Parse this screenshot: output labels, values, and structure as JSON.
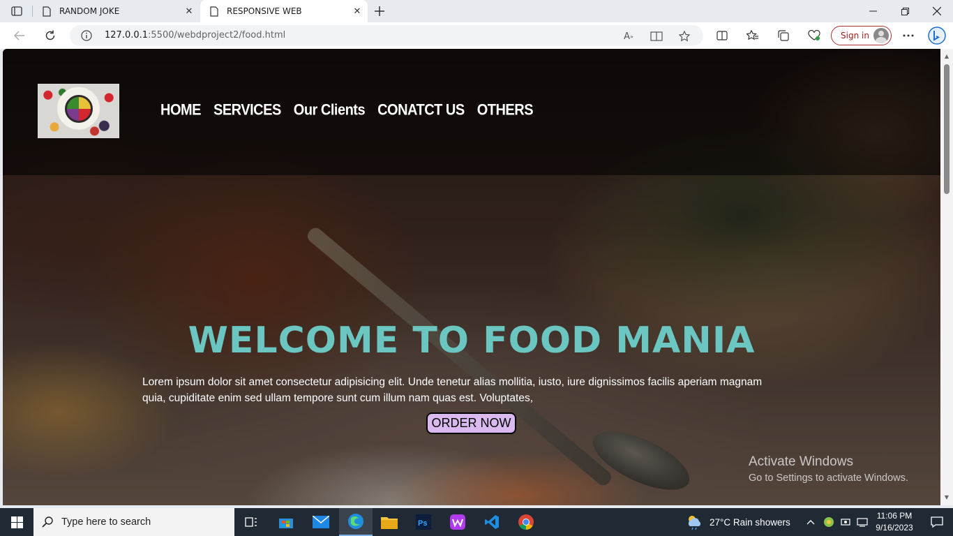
{
  "browser": {
    "tabs": [
      {
        "title": "RANDOM JOKE",
        "active": false
      },
      {
        "title": "RESPONSIVE WEB",
        "active": true
      }
    ],
    "url_host": "127.0.0.1",
    "url_path": ":5500/webdproject2/food.html",
    "signin_label": "Sign in"
  },
  "page": {
    "nav": [
      "HOME",
      "SERVICES",
      "Our Clients",
      "CONATCT US",
      "OTHERS"
    ],
    "hero_title": "WELCOME TO FOOD MANIA",
    "hero_text": "Lorem ipsum dolor sit amet consectetur adipisicing elit. Unde tenetur alias mollitia, iusto, iure dignissimos facilis aperiam magnam quia, cupiditate enim sed ullam tempore sunt cum illum nam quas est. Voluptates,",
    "order_button": "ORDER NOW",
    "title_color": "#6bc6c2",
    "button_color": "#d9b9ef"
  },
  "watermark": {
    "line1": "Activate Windows",
    "line2": "Go to Settings to activate Windows."
  },
  "taskbar": {
    "search_placeholder": "Type here to search",
    "weather": "27°C  Rain showers",
    "time": "11:06 PM",
    "date": "9/16/2023"
  }
}
